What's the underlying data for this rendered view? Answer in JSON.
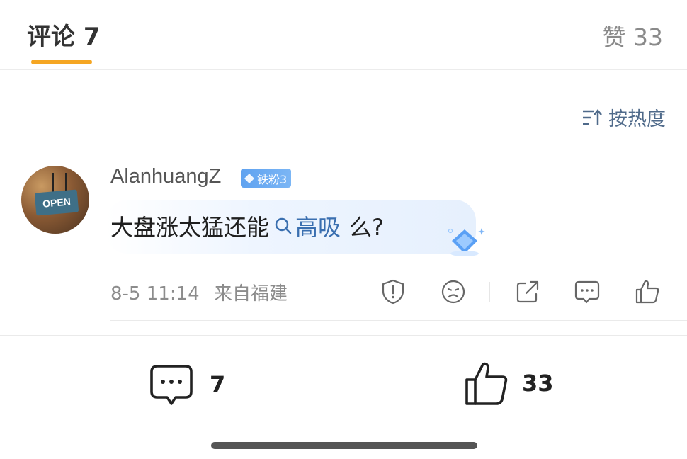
{
  "tabs": {
    "comments_label": "评论 7",
    "likes_label": "赞 33"
  },
  "sort": {
    "label": "按热度"
  },
  "comment": {
    "username": "AlanhuangZ",
    "badge": "铁粉3",
    "text_before": "大盘涨太猛还能",
    "search_tag": "高吸",
    "text_after": "么?",
    "timestamp": "8-5 11:14",
    "location": "来自福建"
  },
  "avatar": {
    "sign_text": "OPEN"
  },
  "bottom_bar": {
    "comment_count": "7",
    "like_count": "33"
  },
  "colors": {
    "accent_underline": "#f5a623",
    "link_blue": "#3a6fb0",
    "badge_blue": "#5fa2f0"
  }
}
